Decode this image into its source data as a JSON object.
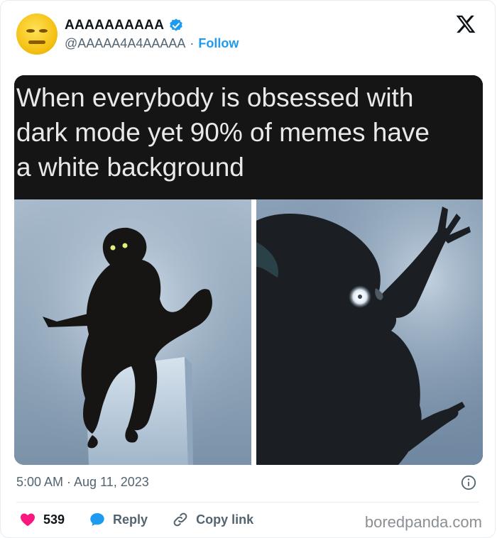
{
  "tweet": {
    "display_name": "AAAAAAAAAA",
    "handle": "@AAAAA4A4AAAAA",
    "separator": "·",
    "follow_label": "Follow",
    "timestamp": "5:00 AM · Aug 11, 2023",
    "likes": "539",
    "reply_label": "Reply",
    "copy_link_label": "Copy link"
  },
  "meme": {
    "caption_lines": [
      "When everybody is obsessed with",
      "dark mode yet 90% of memes have",
      "a white background"
    ]
  },
  "watermark": "boredpanda.com",
  "colors": {
    "verified": "#1d9bf0",
    "follow": "#1d9bf0",
    "like": "#f91880",
    "reply": "#1d9bf0"
  },
  "icons": [
    "x-logo-icon",
    "verified-badge-icon",
    "info-icon",
    "heart-icon",
    "reply-bubble-icon",
    "link-icon"
  ]
}
